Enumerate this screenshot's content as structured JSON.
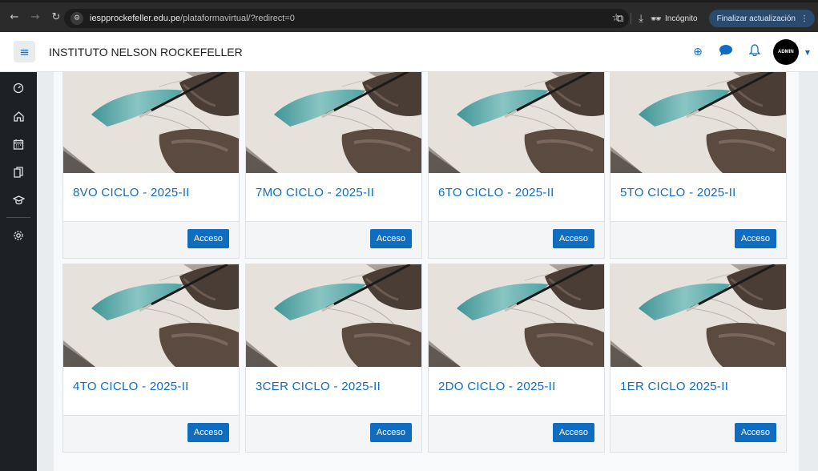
{
  "browser": {
    "url_domain": "iespprockefeller.edu.pe",
    "url_path": "/plataformavirtual/?redirect=0",
    "incognito_label": "Incógnito",
    "update_label": "Finalizar actualización"
  },
  "header": {
    "site_name": "INSTITUTO NELSON ROCKEFELLER",
    "avatar_text": "ADMIN"
  },
  "courses": [
    {
      "title": "8VO CICLO - 2025-II",
      "button": "Acceso"
    },
    {
      "title": "7MO CICLO - 2025-II",
      "button": "Acceso"
    },
    {
      "title": "6TO CICLO - 2025-II",
      "button": "Acceso"
    },
    {
      "title": "5TO CICLO - 2025-II",
      "button": "Acceso"
    },
    {
      "title": "4TO CICLO - 2025-II",
      "button": "Acceso"
    },
    {
      "title": "3CER CICLO - 2025-II",
      "button": "Acceso"
    },
    {
      "title": "2DO CICLO - 2025-II",
      "button": "Acceso"
    },
    {
      "title": "1ER CICLO 2025-II",
      "button": "Acceso"
    }
  ],
  "icons": {
    "rail": [
      "dashboard-icon",
      "home-icon",
      "calendar-icon",
      "files-icon",
      "graduation-cap-icon",
      "settings-icon"
    ],
    "header": [
      "language-icon",
      "messages-icon",
      "notifications-icon"
    ]
  },
  "colors": {
    "brand_blue": "#0f6cbf",
    "rail_bg": "#1d2125",
    "chrome_bg": "#2b2b2b"
  }
}
